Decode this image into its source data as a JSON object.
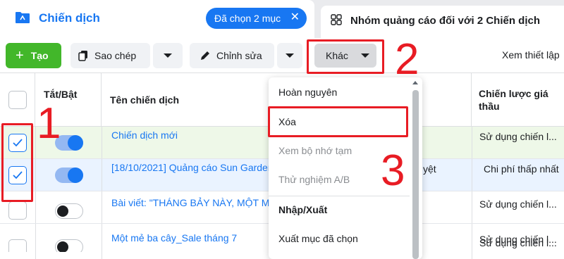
{
  "tabs": {
    "campaign_title": "Chiến dịch",
    "selected_chip": "Đã chọn 2 mục",
    "chip_close": "✕",
    "adsets_title": "Nhóm quảng cáo đối với 2 Chiến dịch"
  },
  "toolbar": {
    "create_label": "Tạo",
    "create_plus": "+",
    "copy_label": "Sao chép",
    "edit_label": "Chỉnh sửa",
    "more_label": "Khác",
    "view_detail": "Xem thiết lập"
  },
  "table": {
    "col_toggle": "Tắt/Bật",
    "col_name": "Tên chiến dịch",
    "col_bid": "Chiến lược giá thầu",
    "rows": [
      {
        "name": "Chiến dịch mới",
        "bid": "Sử dụng chiến l...",
        "checked": true,
        "on": true
      },
      {
        "name": "[18/10/2021] Quảng cáo Sun Garden",
        "bid": "Chi phí thấp nhất",
        "checked": true,
        "on": true
      },
      {
        "name": "Bài viết: \"THÁNG BẢY NÀY, MỘT M",
        "bid": "Sử dụng chiến l...",
        "checked": false,
        "on": false
      },
      {
        "name": "Một mẻ ba cây_Sale tháng 7",
        "bid": "Sử dụng chiến l...",
        "checked": false,
        "on": false
      },
      {
        "name": "",
        "bid": "Sử dụng chiến l...",
        "checked": false,
        "on": false
      }
    ],
    "row2_fragment": "yệt"
  },
  "dropdown": {
    "items": [
      {
        "label": "Hoàn nguyên",
        "state": "enabled"
      },
      {
        "label": "Xóa",
        "state": "enabled"
      },
      {
        "label": "Xem bộ nhớ tạm",
        "state": "disabled"
      },
      {
        "label": "Thử nghiệm A/B",
        "state": "disabled"
      },
      {
        "label": "Nhập/Xuất",
        "state": "header"
      },
      {
        "label": "Xuất mục đã chọn",
        "state": "enabled"
      }
    ]
  },
  "annotations": {
    "step1": "1",
    "step2": "2",
    "step3": "3"
  },
  "colors": {
    "brand_blue": "#1877f2",
    "create_green": "#42b72a",
    "annotation_red": "#e81c24",
    "row_selected_green": "#eef8e8",
    "row_selected_blue": "#eaf3ff"
  }
}
